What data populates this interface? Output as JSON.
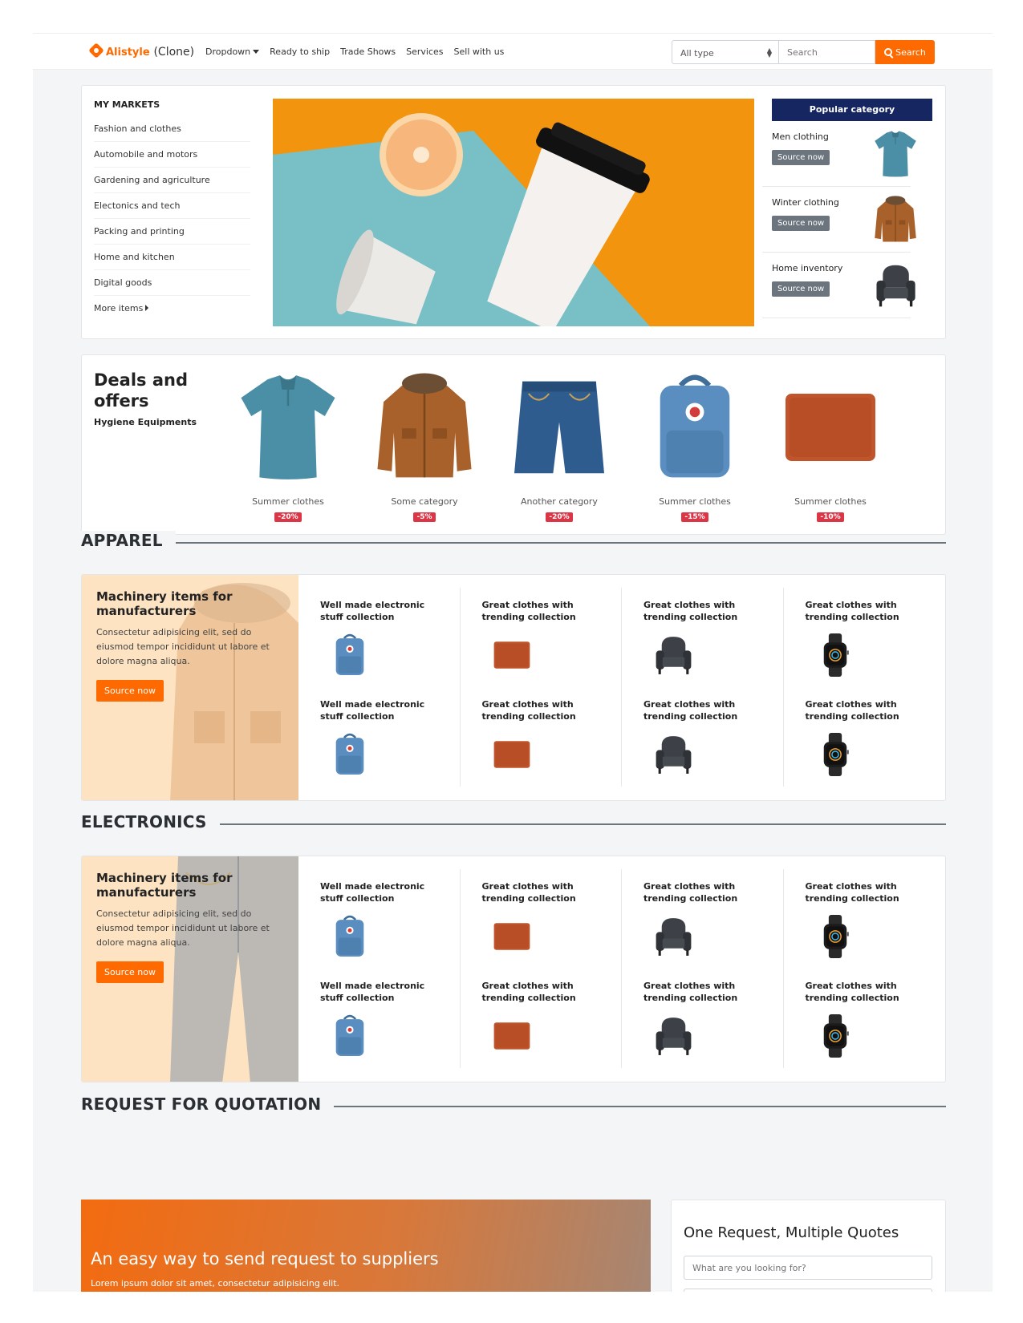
{
  "navbar": {
    "brand_name": "Alistyle",
    "brand_suffix": "(Clone)",
    "links": [
      "Dropdown",
      "Ready to ship",
      "Trade Shows",
      "Services",
      "Sell with us"
    ],
    "search_type": "All type",
    "search_placeholder": "Search",
    "search_button": "Search",
    "accent_color": "#ff6a00"
  },
  "markets": {
    "title": "MY MARKETS",
    "items": [
      "Fashion and clothes",
      "Automobile and motors",
      "Gardening and agriculture",
      "Electonics and tech",
      "Packing and printing",
      "Home and kitchen",
      "Digital goods",
      "More items"
    ]
  },
  "popular": {
    "title": "Popular category",
    "items": [
      {
        "name": "Men clothing",
        "button": "Source now",
        "icon": "tshirt-icon"
      },
      {
        "name": "Winter clothing",
        "button": "Source now",
        "icon": "jacket-icon"
      },
      {
        "name": "Home inventory",
        "button": "Source now",
        "icon": "armchair-icon"
      }
    ]
  },
  "deals": {
    "title": "Deals and offers",
    "subtitle": "Hygiene Equipments",
    "items": [
      {
        "label": "Summer clothes",
        "badge": "-20%",
        "icon": "tshirt-icon"
      },
      {
        "label": "Some category",
        "badge": "-5%",
        "icon": "jacket-icon"
      },
      {
        "label": "Another category",
        "badge": "-20%",
        "icon": "shorts-icon"
      },
      {
        "label": "Summer clothes",
        "badge": "-15%",
        "icon": "backpack-icon"
      },
      {
        "label": "Summer clothes",
        "badge": "-10%",
        "icon": "wallet-icon"
      }
    ]
  },
  "sections": {
    "apparel": "APPAREL",
    "electronics": "ELECTRONICS",
    "rfq": "REQUEST FOR QUOTATION"
  },
  "apparel_block": {
    "promo_title": "Machinery items for manufacturers",
    "promo_text": "Consectetur adipisicing elit, sed do eiusmod tempor incididunt ut labore et dolore magna aliqua.",
    "promo_button": "Source now",
    "items": [
      {
        "title": "Well made electronic stuff collection",
        "icon": "backpack-icon"
      },
      {
        "title": "Great clothes with trending collection",
        "icon": "wallet-icon"
      },
      {
        "title": "Great clothes with trending collection",
        "icon": "armchair-icon"
      },
      {
        "title": "Great clothes with trending collection",
        "icon": "smartwatch-icon"
      },
      {
        "title": "Well made electronic stuff collection",
        "icon": "backpack-icon"
      },
      {
        "title": "Great clothes with trending collection",
        "icon": "wallet-icon"
      },
      {
        "title": "Great clothes with trending collection",
        "icon": "armchair-icon"
      },
      {
        "title": "Great clothes with trending collection",
        "icon": "smartwatch-icon"
      }
    ]
  },
  "electronics_block": {
    "promo_title": "Machinery items for manufacturers",
    "promo_text": "Consectetur adipisicing elit, sed do eiusmod tempor incididunt ut labore et dolore magna aliqua.",
    "promo_button": "Source now",
    "items": [
      {
        "title": "Well made electronic stuff collection",
        "icon": "backpack-icon"
      },
      {
        "title": "Great clothes with trending collection",
        "icon": "wallet-icon"
      },
      {
        "title": "Great clothes with trending collection",
        "icon": "armchair-icon"
      },
      {
        "title": "Great clothes with trending collection",
        "icon": "smartwatch-icon"
      },
      {
        "title": "Well made electronic stuff collection",
        "icon": "backpack-icon"
      },
      {
        "title": "Great clothes with trending collection",
        "icon": "wallet-icon"
      },
      {
        "title": "Great clothes with trending collection",
        "icon": "armchair-icon"
      },
      {
        "title": "Great clothes with trending collection",
        "icon": "smartwatch-icon"
      }
    ]
  },
  "rfq": {
    "banner_title": "An easy way to send request to suppliers",
    "banner_text": "Lorem ipsum dolor sit amet, consectetur adipisicing elit.",
    "form_title": "One Request, Multiple Quotes",
    "input_placeholder": "What are you looking for?"
  }
}
